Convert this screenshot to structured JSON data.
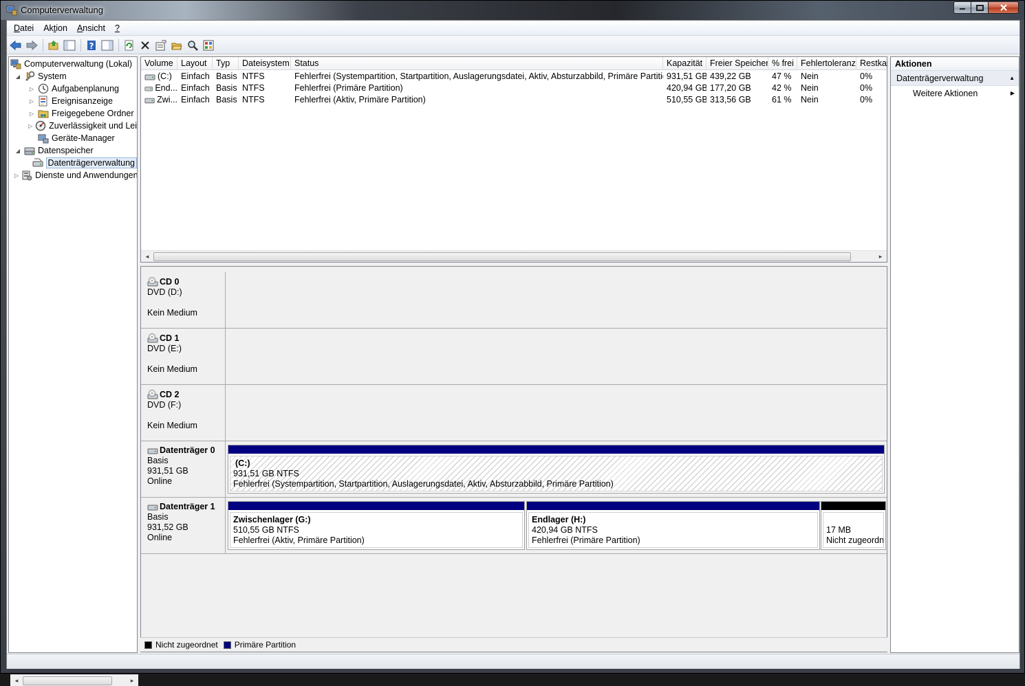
{
  "window": {
    "title": "Computerverwaltung"
  },
  "menu": [
    {
      "label": "Datei",
      "ul": "D",
      "rest": "atei"
    },
    {
      "label": "Aktion",
      "pre": "Ak",
      "ul": "t",
      "rest": "ion"
    },
    {
      "label": "Ansicht",
      "ul": "A",
      "rest": "nsicht"
    },
    {
      "label": "?",
      "ul": "?",
      "rest": ""
    }
  ],
  "toolbar": [
    "back-icon",
    "forward-icon",
    "up-folder-icon",
    "show-tree-icon",
    "help-icon",
    "properties-pane-icon",
    "refresh-icon",
    "delete-icon",
    "properties-icon",
    "open-icon",
    "search-icon",
    "settings-icon"
  ],
  "tree": {
    "items": [
      {
        "label": "Computerverwaltung (Lokal)",
        "level": 0,
        "expander": "",
        "icon": "computer-icon"
      },
      {
        "label": "System",
        "level": 1,
        "expander": "◢",
        "icon": "tools-icon"
      },
      {
        "label": "Aufgabenplanung",
        "level": 2,
        "expander": "▷",
        "icon": "clock-icon"
      },
      {
        "label": "Ereignisanzeige",
        "level": 2,
        "expander": "▷",
        "icon": "event-viewer-icon"
      },
      {
        "label": "Freigegebene Ordner",
        "level": 2,
        "expander": "▷",
        "icon": "shared-folder-icon"
      },
      {
        "label": "Zuverlässigkeit und Leis",
        "level": 2,
        "expander": "▷",
        "icon": "performance-icon"
      },
      {
        "label": "Geräte-Manager",
        "level": 2,
        "expander": "",
        "icon": "device-manager-icon"
      },
      {
        "label": "Datenspeicher",
        "level": 1,
        "expander": "◢",
        "icon": "storage-icon"
      },
      {
        "label": "Datenträgerverwaltung",
        "level": 2,
        "expander": "",
        "icon": "disk-management-icon",
        "selected": true
      },
      {
        "label": "Dienste und Anwendungen",
        "level": 1,
        "expander": "▷",
        "icon": "services-icon"
      }
    ]
  },
  "volume_list": {
    "columns": [
      "Volume",
      "Layout",
      "Typ",
      "Dateisystem",
      "Status",
      "Kapazität",
      "Freier Speicher",
      "% frei",
      "Fehlertoleranz",
      "Restkap"
    ],
    "rows": [
      [
        "(C:)",
        "Einfach",
        "Basis",
        "NTFS",
        "Fehlerfrei (Systempartition, Startpartition, Auslagerungsdatei, Aktiv, Absturzabbild, Primäre Partition)",
        "931,51 GB",
        "439,22 GB",
        "47 %",
        "Nein",
        "0%"
      ],
      [
        "End...",
        "Einfach",
        "Basis",
        "NTFS",
        "Fehlerfrei (Primäre Partition)",
        "420,94 GB",
        "177,20 GB",
        "42 %",
        "Nein",
        "0%"
      ],
      [
        "Zwi...",
        "Einfach",
        "Basis",
        "NTFS",
        "Fehlerfrei (Aktiv, Primäre Partition)",
        "510,55 GB",
        "313,56 GB",
        "61 %",
        "Nein",
        "0%"
      ]
    ]
  },
  "disks": {
    "cd0": {
      "name": "CD 0",
      "line1": "DVD (D:)",
      "line2": "",
      "line3": "Kein Medium"
    },
    "cd1": {
      "name": "CD 1",
      "line1": "DVD (E:)",
      "line2": "",
      "line3": "Kein Medium"
    },
    "cd2": {
      "name": "CD 2",
      "line1": "DVD (F:)",
      "line2": "",
      "line3": "Kein Medium"
    },
    "disk0": {
      "name": "Datenträger 0",
      "line1": "Basis",
      "line2": "931,51 GB",
      "line3": "Online",
      "partitions": [
        {
          "title": "(C:)",
          "size": "931,51 GB NTFS",
          "status": "Fehlerfrei (Systempartition, Startpartition, Auslagerungsdatei, Aktiv, Absturzabbild, Primäre Partition)",
          "kind": "primary"
        }
      ]
    },
    "disk1": {
      "name": "Datenträger 1",
      "line1": "Basis",
      "line2": "931,52 GB",
      "line3": "Online",
      "partitions": [
        {
          "title": "Zwischenlager  (G:)",
          "size": "510,55 GB NTFS",
          "status": "Fehlerfrei (Aktiv, Primäre Partition)",
          "kind": "primary"
        },
        {
          "title": "Endlager  (H:)",
          "size": "420,94 GB NTFS",
          "status": "Fehlerfrei (Primäre Partition)",
          "kind": "primary"
        },
        {
          "title": "",
          "size": "17 MB",
          "status": "Nicht zugeordn",
          "kind": "unallocated"
        }
      ]
    }
  },
  "legend": [
    {
      "label": "Nicht zugeordnet",
      "color": "#000000"
    },
    {
      "label": "Primäre Partition",
      "color": "#000080"
    }
  ],
  "actions": {
    "header": "Aktionen",
    "group": "Datenträgerverwaltung",
    "items": [
      "Weitere Aktionen"
    ]
  },
  "colors": {
    "primary_partition": "#000080",
    "unallocated": "#000000",
    "selection": "#e3ecf7"
  }
}
